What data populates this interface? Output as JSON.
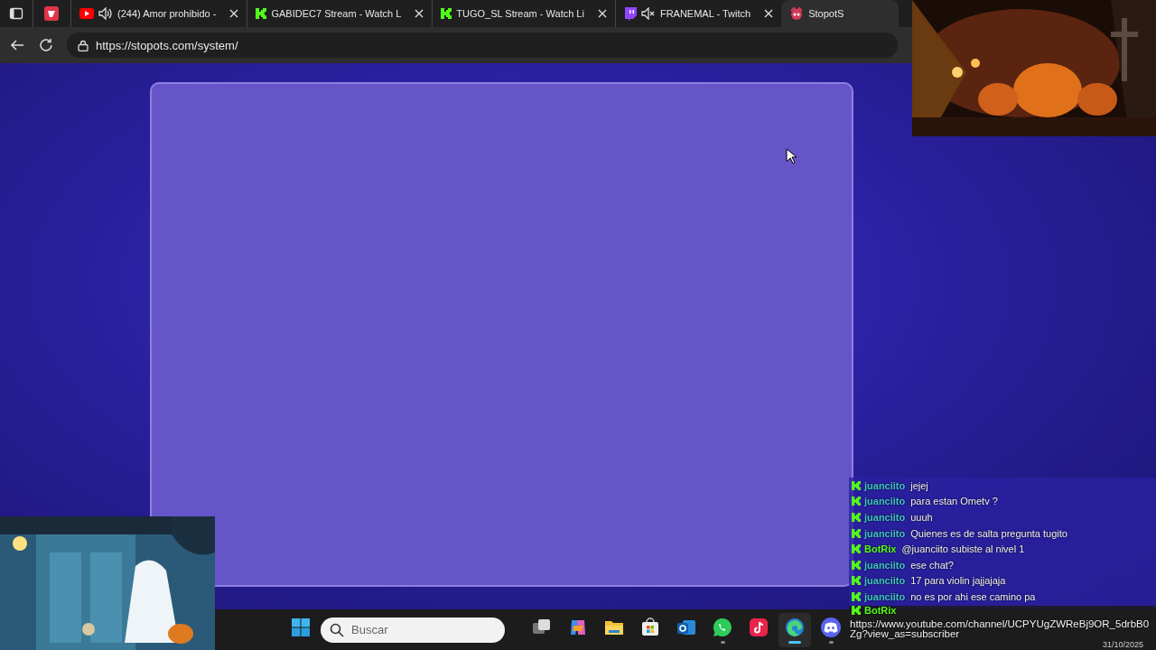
{
  "tabs": [
    {
      "kind": "pinned",
      "selected": false
    },
    {
      "kind": "youtube",
      "title": "(244) Amor prohibido -",
      "muted": false,
      "selected": false
    },
    {
      "kind": "kick",
      "title": "GABIDEC7 Stream - Watch L",
      "selected": false
    },
    {
      "kind": "kick",
      "title": "TUGO_SL Stream - Watch Li",
      "selected": false
    },
    {
      "kind": "twitch",
      "title": "FRANEMAL - Twitch",
      "muted": true,
      "selected": false
    },
    {
      "kind": "stopots",
      "title": "StopotS",
      "selected": true
    }
  ],
  "address_bar": {
    "url": "https://stopots.com/system/"
  },
  "chat": {
    "messages": [
      {
        "user": "juanciito",
        "text": "jejej",
        "color": "#3fc6c6"
      },
      {
        "user": "juanciito",
        "text": "para estan Ometv ?",
        "color": "#3fc6c6"
      },
      {
        "user": "juanciito",
        "text": "uuuh",
        "color": "#3fc6c6"
      },
      {
        "user": "juanciito",
        "text": "Quienes es de salta pregunta tugito",
        "color": "#3fc6c6"
      },
      {
        "user": "BotRix",
        "text": "@juanciito subiste al nivel 1",
        "color": "#53fc18"
      },
      {
        "user": "juanciito",
        "text": "ese chat?",
        "color": "#3fc6c6"
      },
      {
        "user": "juanciito",
        "text": "17 para violin jajjajaja",
        "color": "#3fc6c6"
      },
      {
        "user": "juanciito",
        "text": "no es por ahi ese camino pa",
        "color": "#3fc6c6"
      },
      {
        "user": "BotRix",
        "text": "https://www.youtube.com/channel/UCPYUgZWReBj9OR_5drbB0Zg?view_as=subscriber",
        "color": "#53fc18"
      }
    ]
  },
  "taskbar": {
    "search": {
      "placeholder": "Buscar"
    },
    "apps": [
      {
        "kind": "start",
        "running": false,
        "selected": false
      },
      {
        "kind": "taskview",
        "running": false,
        "selected": false
      },
      {
        "kind": "copilot",
        "running": false,
        "selected": false
      },
      {
        "kind": "files",
        "running": false,
        "selected": false
      },
      {
        "kind": "store",
        "running": false,
        "selected": false
      },
      {
        "kind": "outlook",
        "running": false,
        "selected": false
      },
      {
        "kind": "whatsapp",
        "running": true,
        "selected": false
      },
      {
        "kind": "tiktok",
        "running": false,
        "selected": false
      },
      {
        "kind": "edge",
        "running": true,
        "selected": true
      },
      {
        "kind": "discord",
        "running": true,
        "selected": false
      }
    ],
    "date": "31/10/2025"
  }
}
